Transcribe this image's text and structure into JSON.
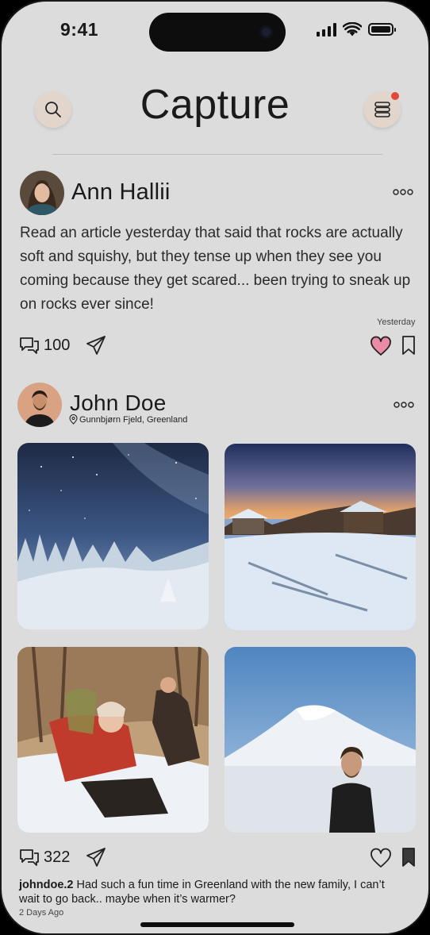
{
  "status_bar": {
    "time": "9:41"
  },
  "header": {
    "title": "Capture",
    "search_icon": "search-icon",
    "menu_icon": "stack-menu-icon",
    "notification_color": "#e0483c"
  },
  "posts": [
    {
      "author": "Ann Hallii",
      "text": "Read an article yesterday that said that rocks are actually soft and squishy, but they tense up when they see you coming because they get scared... been trying to sneak up on rocks ever since!",
      "timestamp": "Yesterday",
      "comment_count": "100",
      "liked": true,
      "like_color": "#e98aa6"
    },
    {
      "author": "John Doe",
      "location": "Gunnbjørn Fjeld, Greenland",
      "photos": [
        "starry-snow-forest",
        "snowy-cabins-sunset",
        "friends-playing-in-snow",
        "man-before-snowy-mountain"
      ],
      "comment_count": "322",
      "liked": false,
      "caption_user": "johndoe.2",
      "caption_text": "Had such a fun time in Greenland with the new family, I can’t wait to go back.. maybe when it’s warmer?",
      "timestamp": "2 Days Ago"
    }
  ]
}
